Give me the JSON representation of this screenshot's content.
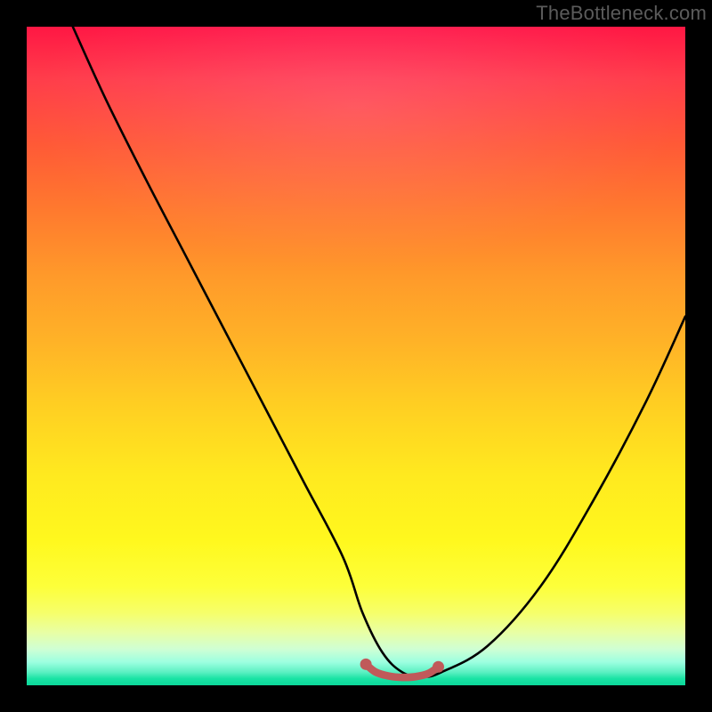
{
  "watermark": "TheBottleneck.com",
  "chart_data": {
    "type": "line",
    "title": "",
    "xlabel": "",
    "ylabel": "",
    "xlim": [
      0,
      100
    ],
    "ylim": [
      0,
      100
    ],
    "grid": false,
    "series": [
      {
        "name": "curve",
        "x": [
          7,
          12,
          18,
          24,
          30,
          36,
          42,
          48,
          51,
          54,
          57,
          60,
          63,
          70,
          78,
          86,
          94,
          100
        ],
        "y": [
          100,
          89,
          77,
          65.5,
          54,
          42.5,
          31,
          19.5,
          11,
          5,
          2,
          1.3,
          2,
          6,
          15,
          28,
          43,
          56
        ],
        "color": "#000000"
      },
      {
        "name": "valley-highlight",
        "x": [
          51.5,
          53,
          55,
          57,
          59,
          61,
          62.5
        ],
        "y": [
          3.2,
          2.0,
          1.4,
          1.2,
          1.3,
          1.8,
          2.8
        ],
        "color": "#c05a5a"
      }
    ],
    "highlight_endpoints": {
      "left": {
        "x": 51.5,
        "y": 3.2
      },
      "right": {
        "x": 62.5,
        "y": 2.8
      }
    }
  },
  "colors": {
    "background": "#000000",
    "curve": "#000000",
    "highlight": "#c05a5a",
    "watermark": "#5b5b5b"
  }
}
